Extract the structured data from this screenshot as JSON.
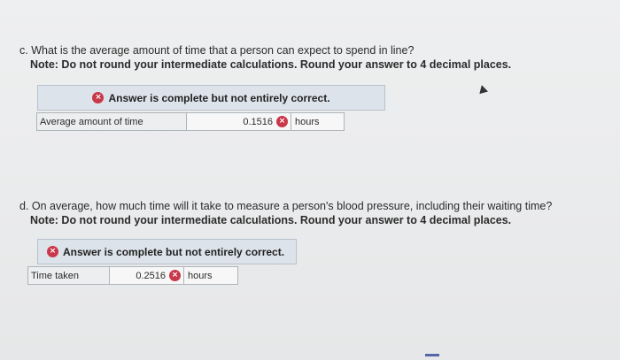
{
  "part_c": {
    "question": "c. What is the average amount of time that a person can expect to spend in line?",
    "note": "Note: Do not round your intermediate calculations. Round your answer to 4 decimal places.",
    "feedback": "Answer is complete but not entirely correct.",
    "field_label": "Average amount of time",
    "value": "0.1516",
    "unit": "hours"
  },
  "part_d": {
    "question": "d. On average, how much time will it take to measure a person's blood pressure, including their waiting time?",
    "note": "Note: Do not round your intermediate calculations. Round your answer to 4 decimal places.",
    "feedback": "Answer is complete but not entirely correct.",
    "field_label": "Time taken",
    "value": "0.2516",
    "unit": "hours"
  },
  "icons": {
    "incorrect": "×"
  },
  "colors": {
    "incorrect": "#c9374a",
    "banner_bg": "#dde3ea"
  }
}
